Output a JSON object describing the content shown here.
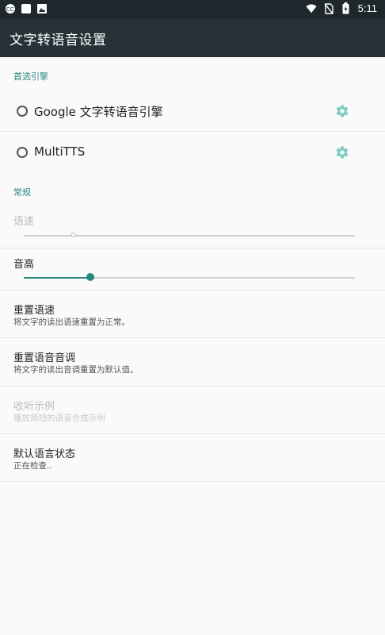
{
  "status_bar": {
    "time": "5:11",
    "left_icons": [
      "cc-icon",
      "app-icon",
      "image-icon"
    ],
    "right_icons": [
      "wifi-icon",
      "no-sim-icon",
      "battery-icon"
    ]
  },
  "app_bar": {
    "title": "文字转语音设置"
  },
  "sections": {
    "preferred_engine": {
      "header": "首选引擎",
      "engines": [
        {
          "label": "Google 文字转语音引擎"
        },
        {
          "label": "MultiTTS"
        }
      ]
    },
    "general": {
      "header": "常规",
      "speech_rate": {
        "title": "语速",
        "value": 0.15,
        "enabled": false
      },
      "pitch": {
        "title": "音高",
        "value": 0.2,
        "enabled": true
      },
      "reset_rate": {
        "title": "重置语速",
        "summary": "将文字的读出语速重置为正常。"
      },
      "reset_pitch": {
        "title": "重置语音音调",
        "summary": "将文字的读出音调重置为默认值。"
      },
      "listen_example": {
        "title": "收听示例",
        "summary": "播放简短的语音合成示例",
        "enabled": false
      },
      "default_language_status": {
        "title": "默认语言状态",
        "summary": "正在检查.."
      }
    }
  },
  "colors": {
    "accent": "#26897f",
    "app_bar": "#263238",
    "status_bar": "#1e272b",
    "background": "#fafafa"
  }
}
